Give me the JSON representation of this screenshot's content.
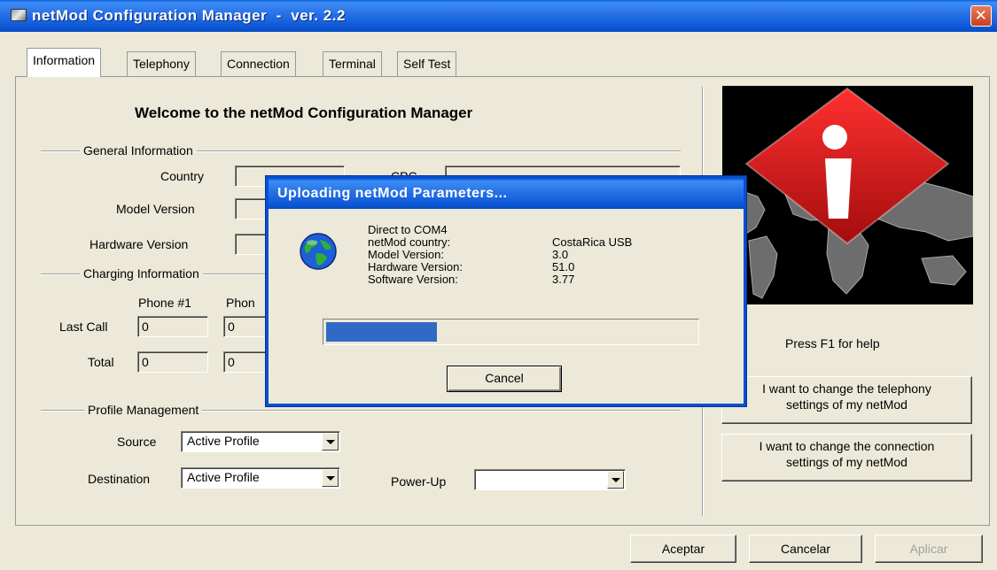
{
  "window": {
    "title": "netMod Configuration Manager  -  ver. 2.2",
    "close_label": "✕"
  },
  "tabs": [
    {
      "label": "Information"
    },
    {
      "label": "Telephony"
    },
    {
      "label": "Connection"
    },
    {
      "label": "Terminal"
    },
    {
      "label": "Self Test"
    }
  ],
  "info": {
    "welcome": "Welcome to the netMod Configuration Manager",
    "general": {
      "heading": "General Information",
      "country_label": "Country",
      "country_value": "",
      "model_version_label": "Model Version",
      "model_version_value": "",
      "hardware_version_label": "Hardware Version",
      "hardware_version_value": "",
      "obscured_label": "CPC",
      "obscured_value": ""
    },
    "charging": {
      "heading": "Charging Information",
      "phone1_label": "Phone #1",
      "phone2_label": "Phon",
      "last_call_label": "Last Call",
      "total_label": "Total",
      "last_call_phone1": "0",
      "last_call_phone2": "0",
      "total_phone1": "0",
      "total_phone2": "0"
    },
    "profile": {
      "heading": "Profile Management",
      "source_label": "Source",
      "source_value": "Active Profile",
      "destination_label": "Destination",
      "destination_value": "Active Profile",
      "powerup_label": "Power-Up",
      "powerup_value": ""
    }
  },
  "side": {
    "help": "Press F1 for help",
    "telephony_button_line1": "I want to change the telephony",
    "telephony_button_line2": "settings of my netMod",
    "connection_button_line1": "I want to change the connection",
    "connection_button_line2": "settings of my netMod"
  },
  "footer": {
    "accept": "Aceptar",
    "cancel": "Cancelar",
    "apply": "Aplicar"
  },
  "dialog": {
    "title": "Uploading netMod Parameters...",
    "connection": "Direct to COM4",
    "rows": [
      {
        "label": "netMod country:",
        "value": "CostaRica USB"
      },
      {
        "label": "Model Version:",
        "value": "3.0"
      },
      {
        "label": "Hardware Version:",
        "value": "51.0"
      },
      {
        "label": "Software Version:",
        "value": "3.77"
      }
    ],
    "progress_fraction": 0.3,
    "cancel": "Cancel"
  },
  "colors": {
    "titlebar_blue": "#0b55d4",
    "progress_blue": "#316ac5",
    "logo_red": "#e0191b",
    "window_bg": "#ece9d8"
  },
  "icons": [
    "app-icon",
    "close-icon",
    "globe-icon",
    "netmod-logo",
    "dropdown-arrow-icon"
  ]
}
